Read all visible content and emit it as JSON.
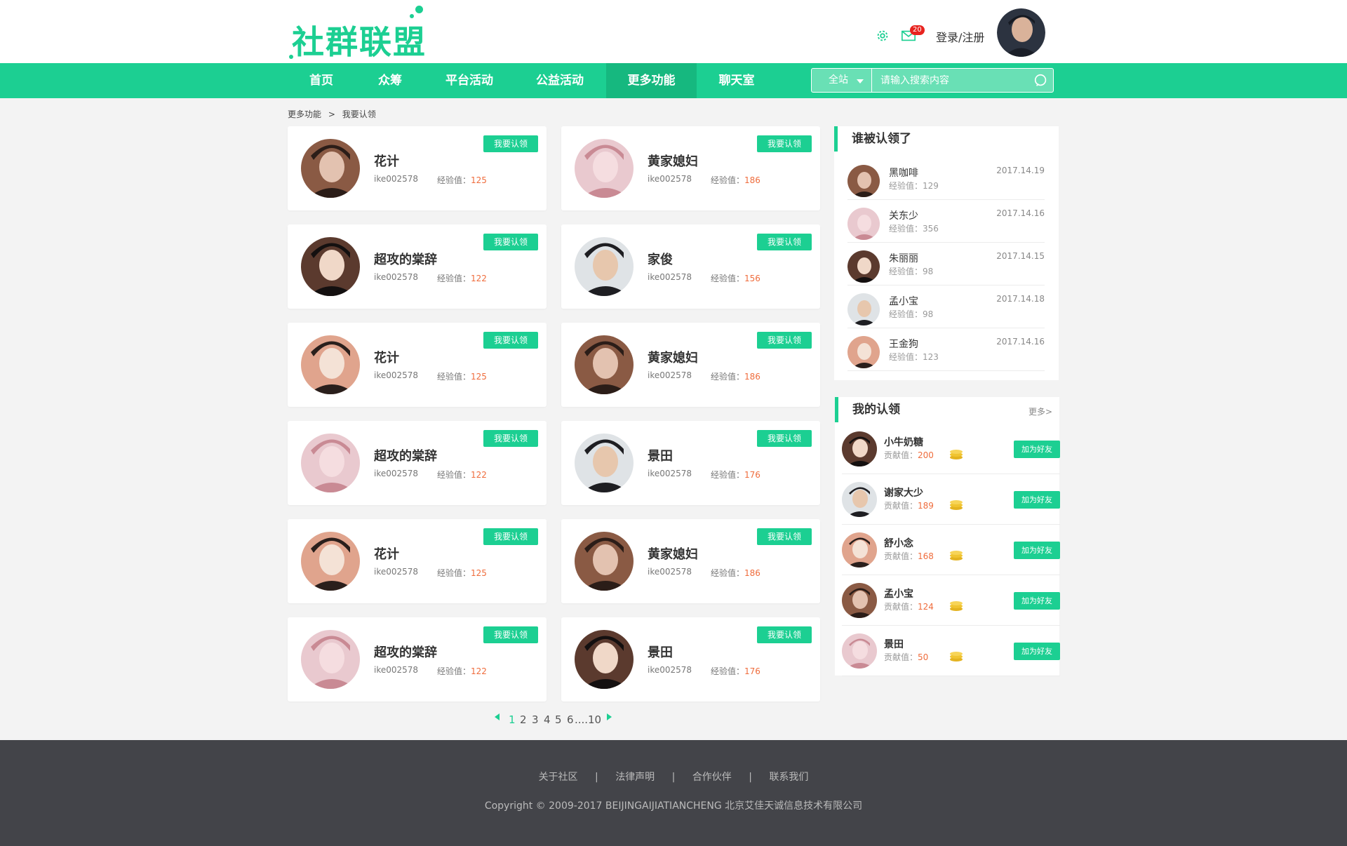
{
  "brand": {
    "logo_text": "社群联盟",
    "accent": "#1ccf92"
  },
  "header": {
    "login_label": "登录/注册",
    "mail_badge": "20"
  },
  "nav": {
    "items": [
      {
        "label": "首页"
      },
      {
        "label": "众筹"
      },
      {
        "label": "平台活动"
      },
      {
        "label": "公益活动"
      },
      {
        "label": "更多功能",
        "active": true
      },
      {
        "label": "聊天室"
      }
    ],
    "search_scope": "全站",
    "search_placeholder": "请输入搜索内容"
  },
  "breadcrumb": {
    "parent": "更多功能",
    "separator": ">",
    "current": "我要认领"
  },
  "cards": {
    "claim_label": "我要认领",
    "exp_label": "经验值：",
    "items": [
      {
        "name": "花计",
        "uid": "ike002578",
        "exp": "125"
      },
      {
        "name": "黄家媳妇",
        "uid": "ike002578",
        "exp": "186"
      },
      {
        "name": "超攻的棠辞",
        "uid": "ike002578",
        "exp": "122"
      },
      {
        "name": "家俊",
        "uid": "ike002578",
        "exp": "156"
      },
      {
        "name": "花计",
        "uid": "ike002578",
        "exp": "125"
      },
      {
        "name": "黄家媳妇",
        "uid": "ike002578",
        "exp": "186"
      },
      {
        "name": "超攻的棠辞",
        "uid": "ike002578",
        "exp": "122"
      },
      {
        "name": "景田",
        "uid": "ike002578",
        "exp": "176"
      },
      {
        "name": "花计",
        "uid": "ike002578",
        "exp": "125"
      },
      {
        "name": "黄家媳妇",
        "uid": "ike002578",
        "exp": "186"
      },
      {
        "name": "超攻的棠辞",
        "uid": "ike002578",
        "exp": "122"
      },
      {
        "name": "景田",
        "uid": "ike002578",
        "exp": "176"
      }
    ]
  },
  "pagination": {
    "pages": [
      "1",
      "2",
      "3",
      "4",
      "5",
      "6",
      "....",
      "10"
    ],
    "current": "1"
  },
  "claimed_panel": {
    "title": "谁被认领了",
    "items": [
      {
        "name": "黑咖啡",
        "exp": "经验值：129",
        "date": "2017.14.19"
      },
      {
        "name": "关东少",
        "exp": "经验值：356",
        "date": "2017.14.16"
      },
      {
        "name": "朱丽丽",
        "exp": "经验值：98",
        "date": "2017.14.15"
      },
      {
        "name": "孟小宝",
        "exp": "经验值：98",
        "date": "2017.14.18"
      },
      {
        "name": "王金狗",
        "exp": "经验值：123",
        "date": "2017.14.16"
      }
    ]
  },
  "my_panel": {
    "title": "我的认领",
    "more": "更多>",
    "contrib_label": "贡献值：",
    "add_label": "加为好友",
    "items": [
      {
        "name": "小牛奶糖",
        "value": "200"
      },
      {
        "name": "谢家大少",
        "value": "189"
      },
      {
        "name": "舒小念",
        "value": "168"
      },
      {
        "name": "孟小宝",
        "value": "124"
      },
      {
        "name": "景田",
        "value": "50"
      }
    ]
  },
  "footer": {
    "links": [
      "关于社区",
      "法律声明",
      "合作伙伴",
      "联系我们"
    ],
    "separator": "|",
    "copyright": "Copyright © 2009-2017 BEIJINGAIJIATIANCHENG 北京艾佳天诚信息技术有限公司"
  }
}
